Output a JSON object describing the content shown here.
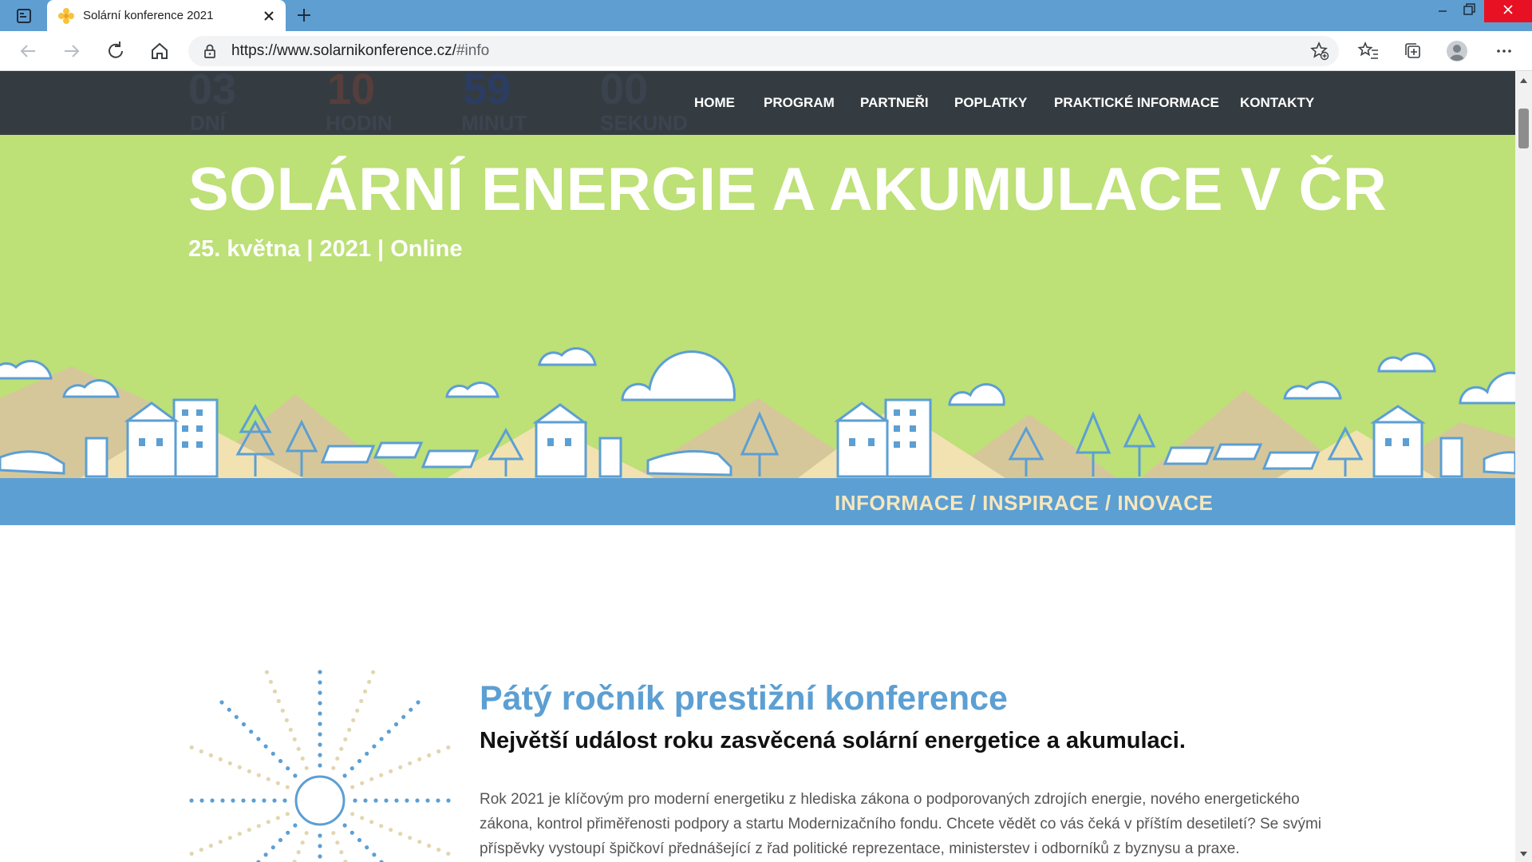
{
  "browser": {
    "tab": {
      "title": "Solární konference 2021"
    },
    "address": {
      "url_main": "https://www.solarnikonference.cz/",
      "url_hash": "#info"
    }
  },
  "colors": {
    "nav_bg": "#353c41",
    "hero_green": "#bde077",
    "accent_blue": "#5c9fd3",
    "tagline_cream": "#f6e7bd",
    "body_text": "#555555"
  },
  "icons": {
    "tab_actions": "tab-actions-icon",
    "favicon": "sun-favicon-icon",
    "close": "close-icon",
    "new_tab": "plus-icon",
    "back": "arrow-left-icon",
    "forward": "arrow-right-icon",
    "refresh": "refresh-icon",
    "home": "home-icon",
    "lock": "lock-icon",
    "add_favorite": "star-add-icon",
    "favorites": "favorites-icon",
    "collections": "collections-icon",
    "profile": "avatar-icon",
    "more": "more-icon"
  },
  "countdown": [
    {
      "value": "03",
      "label": "DNÍ"
    },
    {
      "value": "10",
      "label": "HODIN"
    },
    {
      "value": "59",
      "label": "MINUT"
    },
    {
      "value": "00",
      "label": "SEKUND"
    }
  ],
  "nav": {
    "items": [
      "HOME",
      "PROGRAM",
      "PARTNEŘI",
      "POPLATKY",
      "PRAKTICKÉ INFORMACE",
      "KONTAKTY"
    ]
  },
  "hero": {
    "title": "SOLÁRNÍ ENERGIE A AKUMULACE V ČR",
    "date_line": "25. května | 2021 | Online"
  },
  "tagline": "INFORMACE / INSPIRACE / INOVACE",
  "about": {
    "heading": "Pátý ročník prestižní konference",
    "subheading": "Největší událost roku zasvěcená solární energetice a akumulaci.",
    "body": "Rok 2021 je klíčovým pro moderní energetiku z hlediska zákona o podporovaných zdrojích energie, nového energetického zákona, kontrol přiměřenosti podpory a startu Modernizačního fondu. Chcete vědět co vás čeká v příštím desetiletí? Se svými příspěvky vystoupí špičkoví přednášející z řad politické reprezentace, ministerstev i odborníků z byznysu a praxe."
  }
}
